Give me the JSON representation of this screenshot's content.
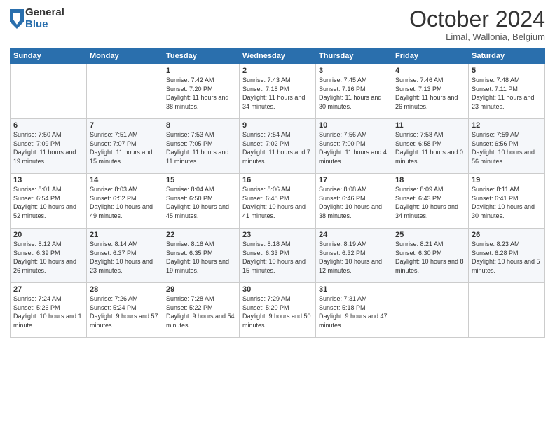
{
  "header": {
    "logo_general": "General",
    "logo_blue": "Blue",
    "title": "October 2024",
    "subtitle": "Limal, Wallonia, Belgium"
  },
  "days_of_week": [
    "Sunday",
    "Monday",
    "Tuesday",
    "Wednesday",
    "Thursday",
    "Friday",
    "Saturday"
  ],
  "weeks": [
    [
      {
        "day": "",
        "content": ""
      },
      {
        "day": "",
        "content": ""
      },
      {
        "day": "1",
        "content": "Sunrise: 7:42 AM\nSunset: 7:20 PM\nDaylight: 11 hours and 38 minutes."
      },
      {
        "day": "2",
        "content": "Sunrise: 7:43 AM\nSunset: 7:18 PM\nDaylight: 11 hours and 34 minutes."
      },
      {
        "day": "3",
        "content": "Sunrise: 7:45 AM\nSunset: 7:16 PM\nDaylight: 11 hours and 30 minutes."
      },
      {
        "day": "4",
        "content": "Sunrise: 7:46 AM\nSunset: 7:13 PM\nDaylight: 11 hours and 26 minutes."
      },
      {
        "day": "5",
        "content": "Sunrise: 7:48 AM\nSunset: 7:11 PM\nDaylight: 11 hours and 23 minutes."
      }
    ],
    [
      {
        "day": "6",
        "content": "Sunrise: 7:50 AM\nSunset: 7:09 PM\nDaylight: 11 hours and 19 minutes."
      },
      {
        "day": "7",
        "content": "Sunrise: 7:51 AM\nSunset: 7:07 PM\nDaylight: 11 hours and 15 minutes."
      },
      {
        "day": "8",
        "content": "Sunrise: 7:53 AM\nSunset: 7:05 PM\nDaylight: 11 hours and 11 minutes."
      },
      {
        "day": "9",
        "content": "Sunrise: 7:54 AM\nSunset: 7:02 PM\nDaylight: 11 hours and 7 minutes."
      },
      {
        "day": "10",
        "content": "Sunrise: 7:56 AM\nSunset: 7:00 PM\nDaylight: 11 hours and 4 minutes."
      },
      {
        "day": "11",
        "content": "Sunrise: 7:58 AM\nSunset: 6:58 PM\nDaylight: 11 hours and 0 minutes."
      },
      {
        "day": "12",
        "content": "Sunrise: 7:59 AM\nSunset: 6:56 PM\nDaylight: 10 hours and 56 minutes."
      }
    ],
    [
      {
        "day": "13",
        "content": "Sunrise: 8:01 AM\nSunset: 6:54 PM\nDaylight: 10 hours and 52 minutes."
      },
      {
        "day": "14",
        "content": "Sunrise: 8:03 AM\nSunset: 6:52 PM\nDaylight: 10 hours and 49 minutes."
      },
      {
        "day": "15",
        "content": "Sunrise: 8:04 AM\nSunset: 6:50 PM\nDaylight: 10 hours and 45 minutes."
      },
      {
        "day": "16",
        "content": "Sunrise: 8:06 AM\nSunset: 6:48 PM\nDaylight: 10 hours and 41 minutes."
      },
      {
        "day": "17",
        "content": "Sunrise: 8:08 AM\nSunset: 6:46 PM\nDaylight: 10 hours and 38 minutes."
      },
      {
        "day": "18",
        "content": "Sunrise: 8:09 AM\nSunset: 6:43 PM\nDaylight: 10 hours and 34 minutes."
      },
      {
        "day": "19",
        "content": "Sunrise: 8:11 AM\nSunset: 6:41 PM\nDaylight: 10 hours and 30 minutes."
      }
    ],
    [
      {
        "day": "20",
        "content": "Sunrise: 8:12 AM\nSunset: 6:39 PM\nDaylight: 10 hours and 26 minutes."
      },
      {
        "day": "21",
        "content": "Sunrise: 8:14 AM\nSunset: 6:37 PM\nDaylight: 10 hours and 23 minutes."
      },
      {
        "day": "22",
        "content": "Sunrise: 8:16 AM\nSunset: 6:35 PM\nDaylight: 10 hours and 19 minutes."
      },
      {
        "day": "23",
        "content": "Sunrise: 8:18 AM\nSunset: 6:33 PM\nDaylight: 10 hours and 15 minutes."
      },
      {
        "day": "24",
        "content": "Sunrise: 8:19 AM\nSunset: 6:32 PM\nDaylight: 10 hours and 12 minutes."
      },
      {
        "day": "25",
        "content": "Sunrise: 8:21 AM\nSunset: 6:30 PM\nDaylight: 10 hours and 8 minutes."
      },
      {
        "day": "26",
        "content": "Sunrise: 8:23 AM\nSunset: 6:28 PM\nDaylight: 10 hours and 5 minutes."
      }
    ],
    [
      {
        "day": "27",
        "content": "Sunrise: 7:24 AM\nSunset: 5:26 PM\nDaylight: 10 hours and 1 minute."
      },
      {
        "day": "28",
        "content": "Sunrise: 7:26 AM\nSunset: 5:24 PM\nDaylight: 9 hours and 57 minutes."
      },
      {
        "day": "29",
        "content": "Sunrise: 7:28 AM\nSunset: 5:22 PM\nDaylight: 9 hours and 54 minutes."
      },
      {
        "day": "30",
        "content": "Sunrise: 7:29 AM\nSunset: 5:20 PM\nDaylight: 9 hours and 50 minutes."
      },
      {
        "day": "31",
        "content": "Sunrise: 7:31 AM\nSunset: 5:18 PM\nDaylight: 9 hours and 47 minutes."
      },
      {
        "day": "",
        "content": ""
      },
      {
        "day": "",
        "content": ""
      }
    ]
  ]
}
